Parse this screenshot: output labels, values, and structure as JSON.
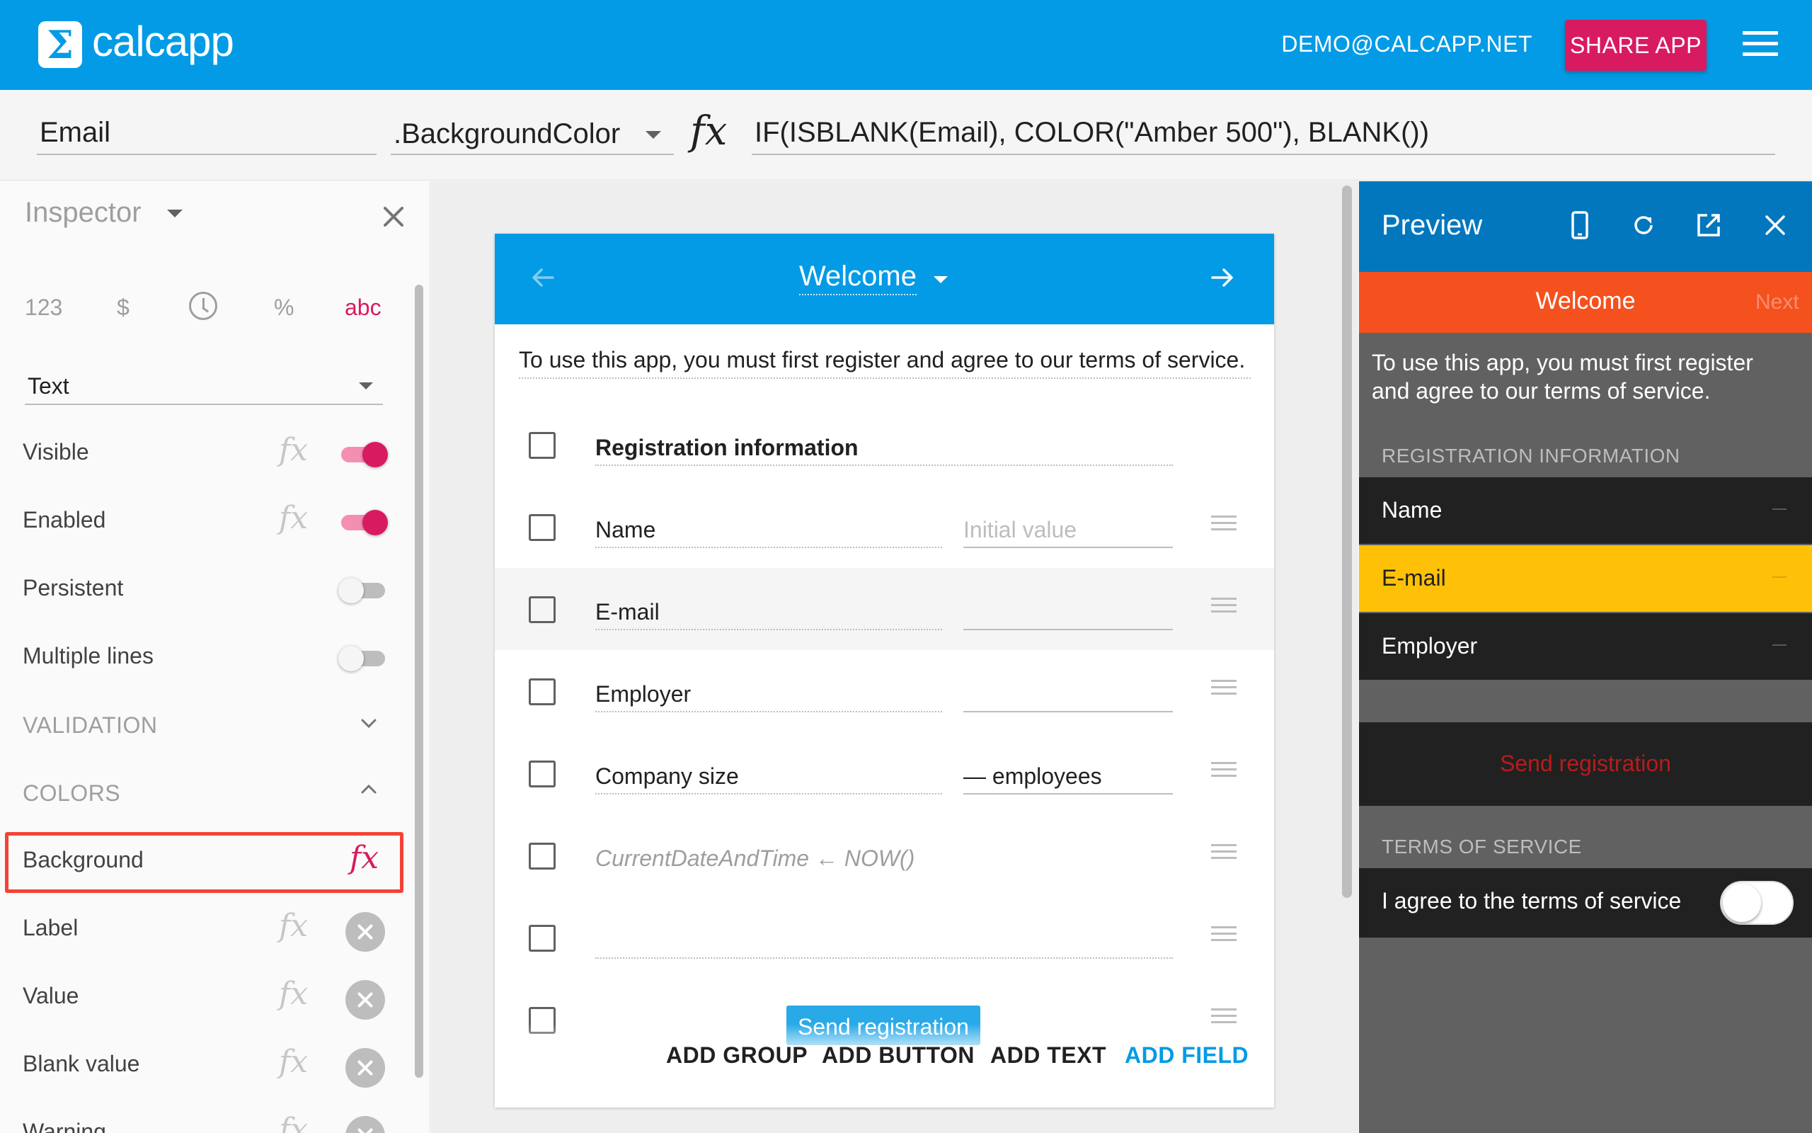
{
  "app": {
    "logo_glyph": "Σ",
    "name": "calcapp",
    "account": "DEMO@CALCAPP.NET",
    "share_label": "SHARE APP",
    "menu_icon": "hamburger-menu-icon",
    "brand_color": "#039be5",
    "accent_color": "#d81b60"
  },
  "formula_bar": {
    "name": "Email",
    "property": ".BackgroundColor",
    "fx": "fx",
    "formula": "IF(ISBLANK(Email), COLOR(\"Amber 500\"), BLANK())"
  },
  "inspector": {
    "title": "Inspector",
    "close_icon": "close-icon",
    "types": [
      "123",
      "$",
      "%",
      "abc"
    ],
    "selected_type": "abc",
    "text_type": "Text",
    "props": [
      {
        "label": "Visible",
        "state": "on"
      },
      {
        "label": "Enabled",
        "state": "on"
      },
      {
        "label": "Persistent",
        "state": "off"
      },
      {
        "label": "Multiple lines",
        "state": "off"
      }
    ],
    "validation_label": "VALIDATION",
    "colors_label": "COLORS",
    "color_props": [
      {
        "label": "Background"
      },
      {
        "label": "Label"
      },
      {
        "label": "Value"
      },
      {
        "label": "Blank value"
      },
      {
        "label": "Warning"
      }
    ],
    "fx": "fx"
  },
  "canvas": {
    "screen_title": "Welcome",
    "intro": "To use this app, you must first register and agree to our terms of service.",
    "rows": [
      {
        "label": "Registration information",
        "value": ""
      },
      {
        "label": "Name",
        "value": "Initial value"
      },
      {
        "label": "E-mail",
        "value": ""
      },
      {
        "label": "Employer",
        "value": ""
      },
      {
        "label": "Company size",
        "value": "— employees"
      },
      {
        "label": "CurrentDateAndTime ← NOW()",
        "value": ""
      },
      {
        "label": "",
        "value": ""
      }
    ],
    "send_label": "Send registration",
    "add_buttons": [
      "ADD GROUP",
      "ADD BUTTON",
      "ADD TEXT",
      "ADD FIELD"
    ]
  },
  "preview": {
    "title": "Preview",
    "bar_title": "Welcome",
    "bar_next": "Next",
    "intro": "To use this app, you must first register and agree to our terms of service.",
    "section_registration": "REGISTRATION INFORMATION",
    "rows": [
      {
        "label": "Name"
      },
      {
        "label": "E-mail"
      },
      {
        "label": "Employer"
      }
    ],
    "highlight_color": "#ffc107",
    "send_label": "Send registration",
    "section_terms": "TERMS OF SERVICE",
    "terms_label": "I agree to the terms of service"
  }
}
